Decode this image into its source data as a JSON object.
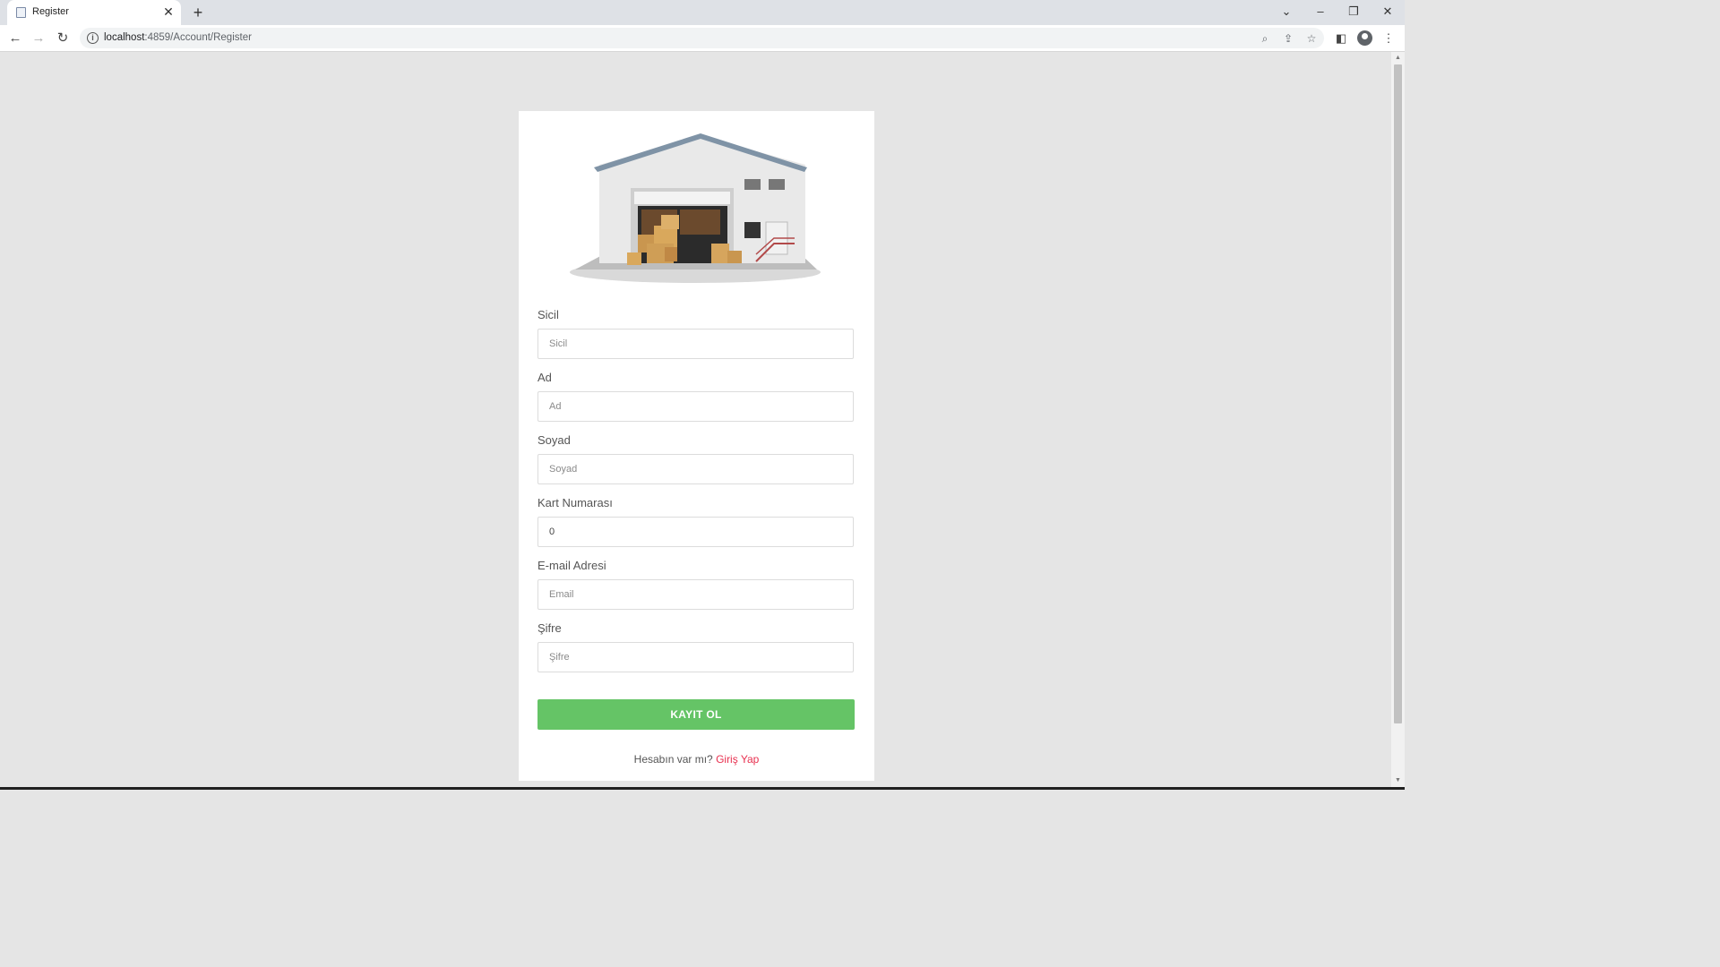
{
  "browser": {
    "tab_title": "Register",
    "url_host": "localhost",
    "url_path": ":4859/Account/Register"
  },
  "form": {
    "fields": [
      {
        "label": "Sicil",
        "placeholder": "Sicil",
        "value": ""
      },
      {
        "label": "Ad",
        "placeholder": "Ad",
        "value": ""
      },
      {
        "label": "Soyad",
        "placeholder": "Soyad",
        "value": ""
      },
      {
        "label": "Kart Numarası",
        "placeholder": "",
        "value": "0"
      },
      {
        "label": "E-mail Adresi",
        "placeholder": "Email",
        "value": ""
      },
      {
        "label": "Şifre",
        "placeholder": "Şifre",
        "value": ""
      }
    ],
    "submit_label": "KAYIT OL",
    "footer_text": "Hesabın var mı?",
    "footer_link": "Giriş Yap"
  },
  "colors": {
    "accent_green": "#65c466",
    "link_red": "#e8304f",
    "page_bg": "#e5e5e5"
  },
  "icons": [
    "back-icon",
    "forward-icon",
    "reload-icon",
    "info-icon",
    "zoom-icon",
    "share-icon",
    "star-icon",
    "side-panel-icon",
    "profile-icon",
    "menu-icon",
    "warehouse-illustration"
  ]
}
